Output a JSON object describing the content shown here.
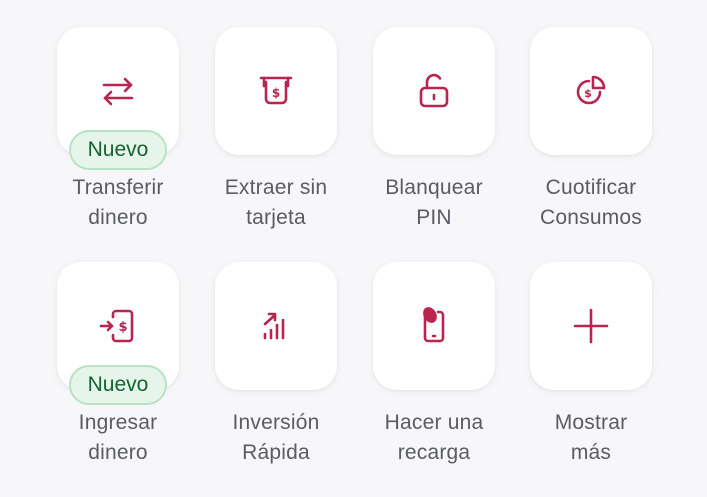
{
  "colors": {
    "accent": "#b8254f",
    "badge_bg": "#e6f5ea",
    "badge_border": "#b7e2c3",
    "badge_text": "#14632f",
    "label_text": "#595c63",
    "background": "#f7f7f9",
    "card": "#ffffff"
  },
  "actions": [
    {
      "icon": "transfer-arrows-icon",
      "line1": "Transferir",
      "line2": "dinero",
      "badge": "Nuevo"
    },
    {
      "icon": "atm-cash-icon",
      "line1": "Extraer sin",
      "line2": "tarjeta"
    },
    {
      "icon": "unlock-icon",
      "line1": "Blanquear",
      "line2": "PIN"
    },
    {
      "icon": "pie-money-icon",
      "line1": "Cuotificar",
      "line2": "Consumos"
    },
    {
      "icon": "deposit-money-icon",
      "line1": "Ingresar",
      "line2": "dinero",
      "badge": "Nuevo"
    },
    {
      "icon": "growth-chart-icon",
      "line1": "Inversión",
      "line2": "Rápida"
    },
    {
      "icon": "phone-recharge-icon",
      "line1": "Hacer una",
      "line2": "recarga"
    },
    {
      "icon": "plus-icon",
      "line1": "Mostrar",
      "line2": "más"
    }
  ]
}
